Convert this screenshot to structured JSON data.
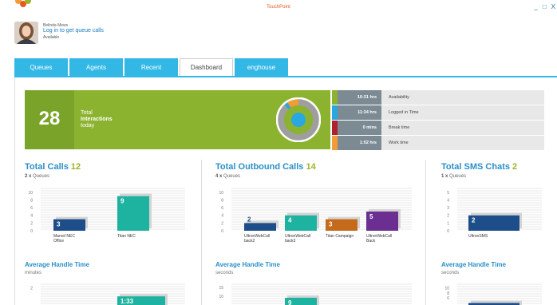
{
  "app": {
    "title": "TouchPoint",
    "window_controls": [
      "_",
      "□",
      "X"
    ]
  },
  "user": {
    "name": "Belinda Mews",
    "login_link": "Log in to get queue calls",
    "status": "Available"
  },
  "tabs": [
    {
      "label": "Queues",
      "active": false
    },
    {
      "label": "Agents",
      "active": false
    },
    {
      "label": "Recent",
      "active": false
    },
    {
      "label": "Dashboard",
      "active": true
    },
    {
      "label": "enghouse",
      "active": false
    }
  ],
  "banner": {
    "count": "28",
    "label_line1": "Total",
    "label_line2": "Interactions",
    "label_line3": "today",
    "donut": [
      {
        "name": "Availability",
        "value": 0.88,
        "color": "#9e9e9e"
      },
      {
        "name": "Logged in Time",
        "value": 0.03,
        "color": "#2aa7e0"
      },
      {
        "name": "Work time",
        "value": 0.09,
        "color": "#f29b38"
      }
    ]
  },
  "stats": [
    {
      "value": "10:31 hrs",
      "label": "Availability",
      "color": "#8cb32f"
    },
    {
      "value": "11:34 hrs",
      "label": "Logged in Time",
      "color": "#2aa7e0"
    },
    {
      "value": "0 mins",
      "label": "Break time",
      "color": "#b0212f"
    },
    {
      "value": "1:02 hrs",
      "label": "Work time",
      "color": "#f29b38"
    }
  ],
  "sections": {
    "calls": {
      "title": "Total Calls",
      "count": "12",
      "queues_count": "2 x",
      "queues_label": "Queues",
      "aht_title": "Average Handle Time",
      "aht_unit": "minutes"
    },
    "outbound": {
      "title": "Total Outbound Calls",
      "count": "14",
      "queues_count": "4 x",
      "queues_label": "Queues",
      "aht_title": "Average Handle Time",
      "aht_unit": "seconds"
    },
    "sms": {
      "title": "Total SMS Chats",
      "count": "2",
      "queues_count": "1 x",
      "queues_label": "Queues",
      "aht_title": "Average Handle Time",
      "aht_unit": "seconds"
    }
  },
  "chart_data": [
    {
      "type": "bar",
      "categories": [
        "Marvel NEC Office",
        "Titan NEC"
      ],
      "values": [
        3,
        9
      ],
      "colors": [
        "#1d4e89",
        "#1eb3a0"
      ],
      "yticks": [
        0,
        2,
        4,
        6,
        8,
        10
      ],
      "ylim": [
        0,
        11
      ]
    },
    {
      "type": "bar",
      "categories": [
        "UltronWebCall back2",
        "UltronWebCall back3",
        "Titan Campaign",
        "UltronWebCall Back"
      ],
      "values": [
        2,
        4,
        3,
        5
      ],
      "colors": [
        "#1d4e89",
        "#1eb3a0",
        "#c46a1a",
        "#6a2f91"
      ],
      "yticks": [
        0,
        2,
        4,
        6,
        8,
        10
      ],
      "ylim": [
        0,
        11
      ]
    },
    {
      "type": "bar",
      "categories": [
        "UltronSMS"
      ],
      "values": [
        2
      ],
      "colors": [
        "#1d4e89"
      ],
      "yticks": [
        0,
        1,
        2,
        3,
        4,
        5
      ],
      "ylim": [
        0,
        5.5
      ]
    },
    {
      "type": "bar",
      "categories": [
        "Marvel NEC Office",
        "Titan NEC"
      ],
      "values": [
        0,
        1.33
      ],
      "value_labels": [
        "",
        "1:33"
      ],
      "colors": [
        "#1d4e89",
        "#1eb3a0"
      ],
      "yticks": [
        2
      ],
      "ylim": [
        0,
        2.3
      ]
    },
    {
      "type": "bar",
      "categories": [
        "UltronWebCall back2",
        "UltronWebCall back3",
        "Titan Campaign",
        "UltronWebCall Back"
      ],
      "values": [
        0,
        9,
        0,
        0
      ],
      "colors": [
        "#1d4e89",
        "#1eb3a0",
        "#c46a1a",
        "#6a2f91"
      ],
      "yticks": [
        10,
        15
      ],
      "ylim": [
        0,
        17
      ]
    },
    {
      "type": "bar",
      "categories": [
        "UltronSMS"
      ],
      "values": [
        4
      ],
      "colors": [
        "#1d4e89"
      ],
      "yticks": [
        6,
        8,
        10
      ],
      "ylim": [
        0,
        11.5
      ]
    }
  ]
}
